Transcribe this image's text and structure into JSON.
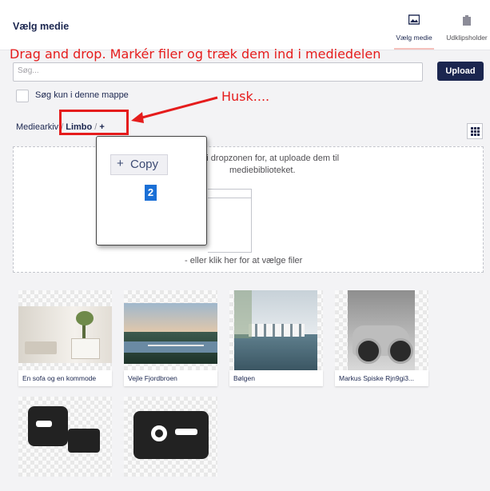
{
  "header": {
    "title": "Vælg medie"
  },
  "tabs": [
    {
      "label": "Vælg medie",
      "icon": "image-icon",
      "active": true
    },
    {
      "label": "Udklipsholder",
      "icon": "clipboard-icon",
      "active": false
    }
  ],
  "annotations": {
    "instruction": "Drag and drop. Markér filer og træk dem ind i mediedelen",
    "note": "Husk...."
  },
  "search": {
    "placeholder": "Søg..."
  },
  "upload_label": "Upload",
  "filter": {
    "label": "Søg kun i denne mappe",
    "checked": false
  },
  "breadcrumb": {
    "root": "Mediearkiv",
    "folder": "Limbo",
    "add": "+"
  },
  "dropzone": {
    "line1": "nd i dropzonen for, at uploade dem til",
    "line2": "mediebiblioteket.",
    "line3": "- eller klik her for at vælge filer"
  },
  "drag_popup": {
    "copy_label": "Copy",
    "count": "2"
  },
  "media": [
    {
      "caption": "En sofa og en kommode"
    },
    {
      "caption": "Vejle Fjordbroen"
    },
    {
      "caption": "Bølgen"
    },
    {
      "caption": "Markus Spiske Rjn9gi3..."
    },
    {
      "caption": ""
    },
    {
      "caption": ""
    }
  ],
  "colors": {
    "primary": "#1b264f",
    "annotation": "#e51c1c",
    "badge": "#1a6fd6"
  }
}
